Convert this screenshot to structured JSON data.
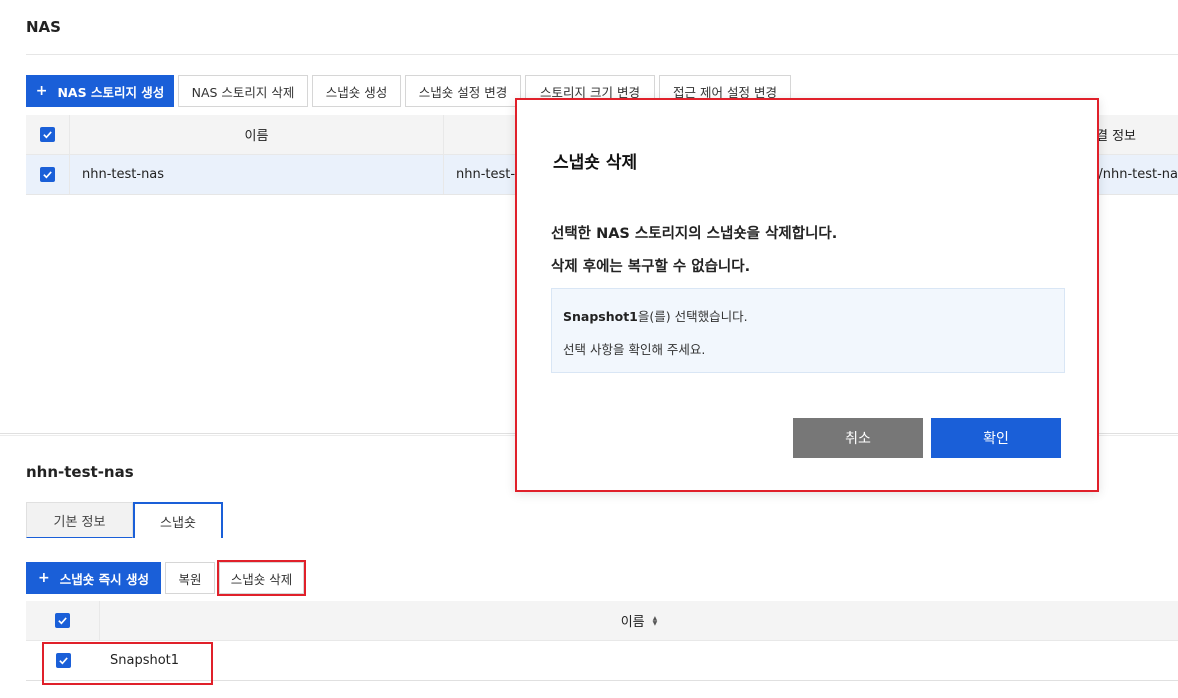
{
  "page": {
    "title": "NAS"
  },
  "toolbar": {
    "create_label": "NAS 스토리지 생성",
    "delete_label": "NAS 스토리지 삭제",
    "snapshot_create_label": "스냅숏 생성",
    "snapshot_settings_label": "스냅숏 설정 변경",
    "resize_label": "스토리지 크기 변경",
    "access_label": "접근 제어 설정 변경"
  },
  "storage_table": {
    "columns": [
      "이름",
      "",
      "결 정보"
    ],
    "rows": [
      {
        "name": "nhn-test-nas",
        "col2": "nhn-test-",
        "col3": ":/nhn-test-na"
      }
    ]
  },
  "detail": {
    "title": "nhn-test-nas",
    "tabs": [
      "기본 정보",
      "스냅숏"
    ],
    "active_tab": "스냅숏",
    "toolbar": {
      "create_now_label": "스냅숏 즉시 생성",
      "restore_label": "복원",
      "delete_label": "스냅숏 삭제"
    },
    "table": {
      "columns": [
        "이름"
      ],
      "rows": [
        {
          "name": "Snapshot1"
        }
      ]
    }
  },
  "modal": {
    "title": "스냅숏 삭제",
    "message_line1": "선택한 NAS 스토리지의 스냅숏을 삭제합니다.",
    "message_line2": "삭제 후에는 복구할 수 없습니다.",
    "info_name": "Snapshot1",
    "info_suffix": "을(를) 선택했습니다.",
    "info_line2": "선택 사항을 확인해 주세요.",
    "cancel_label": "취소",
    "ok_label": "확인"
  },
  "colors": {
    "accent": "#1a5fd8",
    "highlight": "#e0202a",
    "selected_row": "#eaf1fb"
  }
}
